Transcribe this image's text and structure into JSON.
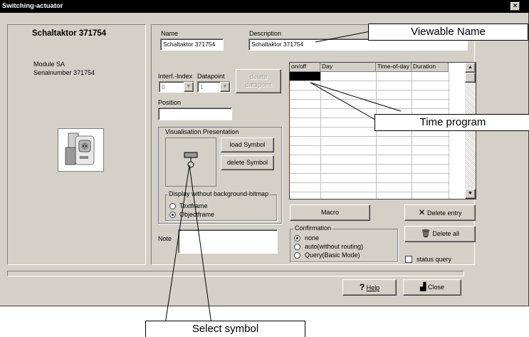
{
  "window": {
    "title": "Switching-actuator",
    "close_glyph": "×"
  },
  "device": {
    "name": "Schaltaktor 371754",
    "module": "Module SA",
    "serial": "Serialnumber 371754"
  },
  "name_field": {
    "label": "Name",
    "value": "Schaltaktor 371754"
  },
  "description_field": {
    "label": "Description",
    "value": "Schaltaktor 371754"
  },
  "datapoint": {
    "interf_index_label": "Interf.-Index",
    "datapoint_label": "Datapoint",
    "interf_index_value": "0",
    "datapoint_value": "1",
    "delete_label": "delete datapoint"
  },
  "position": {
    "label": "Position",
    "value": ""
  },
  "visualisation": {
    "group_label": "Visualisation Presentation",
    "load_label": "load Symbol",
    "delete_label": "delete Symbol"
  },
  "display": {
    "group_label": "Display without background-bitmap",
    "options": [
      "Textframe",
      "Objectframe"
    ],
    "selected": "Objectframe"
  },
  "note": {
    "label": "Note",
    "value": ""
  },
  "time_table": {
    "columns": [
      "on/off",
      "Day",
      "Time-of-day",
      "Duration"
    ],
    "rows": 15
  },
  "buttons": {
    "macro": "Macro",
    "delete_entry": "Delete entry",
    "delete_all": "Delete all",
    "help": "Help",
    "close": "Close"
  },
  "confirmation": {
    "group_label": "Confirmation",
    "options": [
      "none",
      "auto(without routing)",
      "Query(Basic Mode)"
    ],
    "selected": "none"
  },
  "status_query": {
    "label": "status query",
    "checked": false
  },
  "annotations": {
    "viewable_name": "Viewable Name",
    "time_program": "Time program",
    "select_symbol": "Select symbol"
  }
}
